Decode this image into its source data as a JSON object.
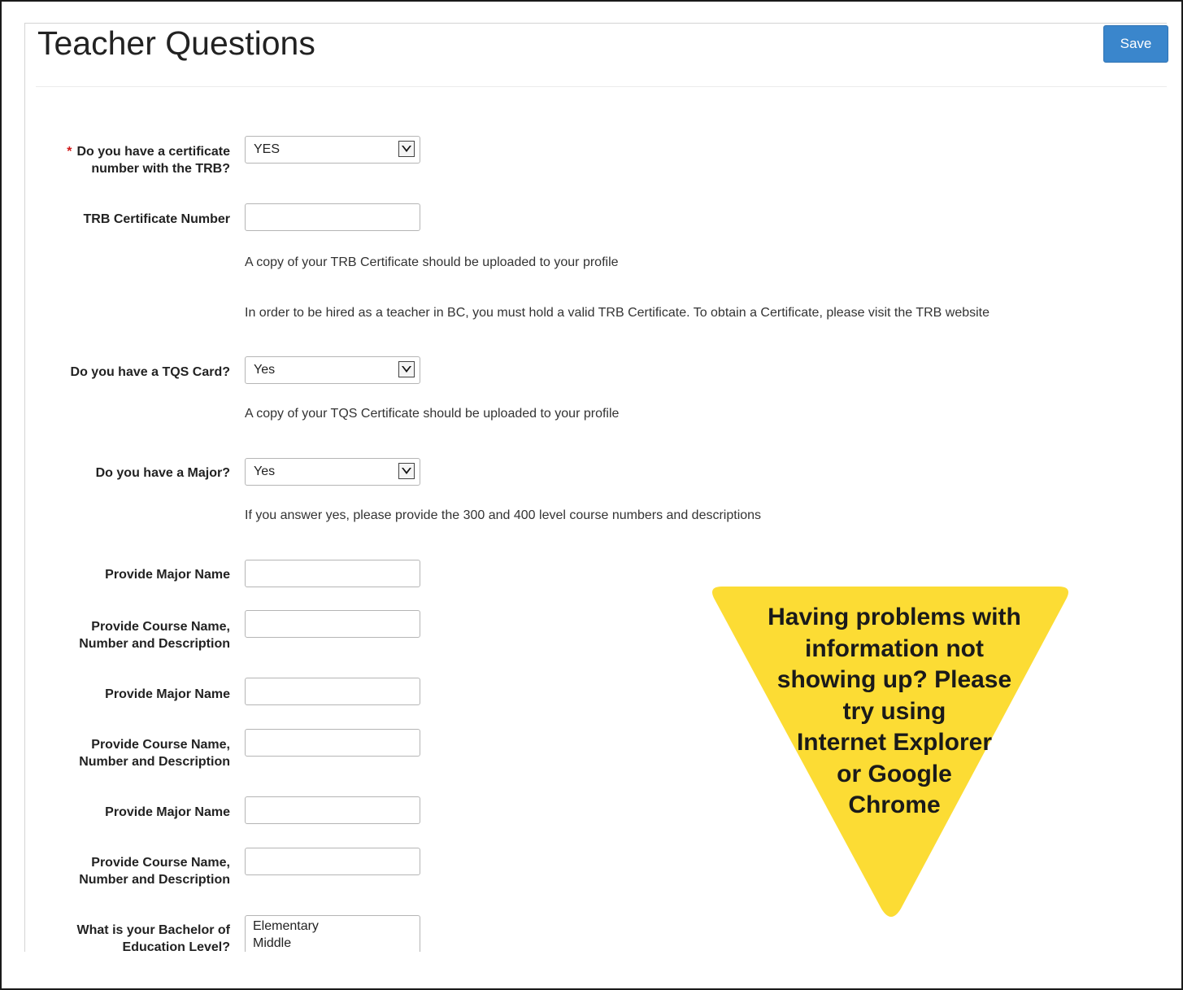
{
  "header": {
    "title": "Teacher Questions",
    "save_label": "Save"
  },
  "form": {
    "trb_question": {
      "required_mark": "*",
      "label_line1": "Do you have a certificate",
      "label_line2": "number with the TRB?",
      "value": "YES"
    },
    "trb_number": {
      "label": "TRB Certificate Number",
      "value": ""
    },
    "trb_help1": "A copy of your TRB Certificate should be uploaded to your profile",
    "trb_help2": "In order to be hired as a teacher in BC, you must hold a valid TRB Certificate. To obtain a Certificate, please visit the TRB website",
    "tqs_question": {
      "label": "Do you have a TQS Card?",
      "value": "Yes"
    },
    "tqs_help": "A copy of your TQS Certificate should be uploaded to your profile",
    "major_question": {
      "label": "Do you have a Major?",
      "value": "Yes"
    },
    "major_help": "If you answer yes, please provide the 300 and 400 level course numbers and descriptions",
    "major_name_label": "Provide Major Name",
    "course_label_line1": "Provide Course Name,",
    "course_label_line2": "Number and Description",
    "bed_question": {
      "label_line1": "What is your Bachelor of",
      "label_line2": "Education Level?",
      "options": [
        "Elementary",
        "Middle"
      ]
    }
  },
  "callout": {
    "lines": [
      "Having problems with",
      "information not",
      "showing up? Please",
      "try using",
      "Internet Explorer",
      "or Google",
      "Chrome"
    ],
    "color": "#fcdc34"
  }
}
